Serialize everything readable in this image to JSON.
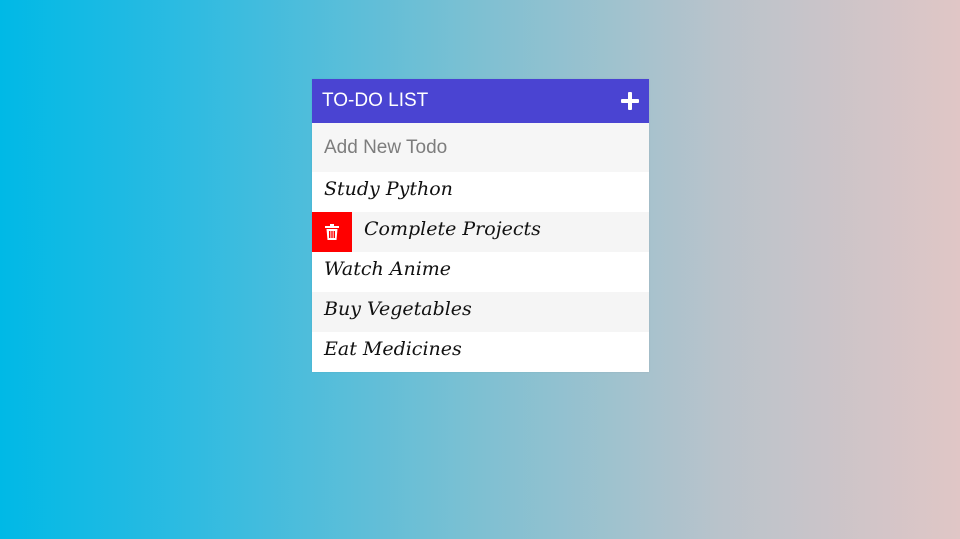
{
  "header": {
    "title": "TO-DO LIST",
    "add_icon": "plus-icon"
  },
  "new_todo": {
    "placeholder": "Add New Todo",
    "value": ""
  },
  "todos": [
    {
      "text": "Study Python"
    },
    {
      "text": "Complete Projects",
      "hovered": true,
      "delete_icon": "trash-icon"
    },
    {
      "text": "Watch Anime"
    },
    {
      "text": "Buy Vegetables"
    },
    {
      "text": "Eat Medicines"
    }
  ],
  "colors": {
    "header_bg": "#4a44d2",
    "delete_bg": "#ff0000",
    "gradient_start": "#00b9e6",
    "gradient_end": "#e0c6c6"
  }
}
